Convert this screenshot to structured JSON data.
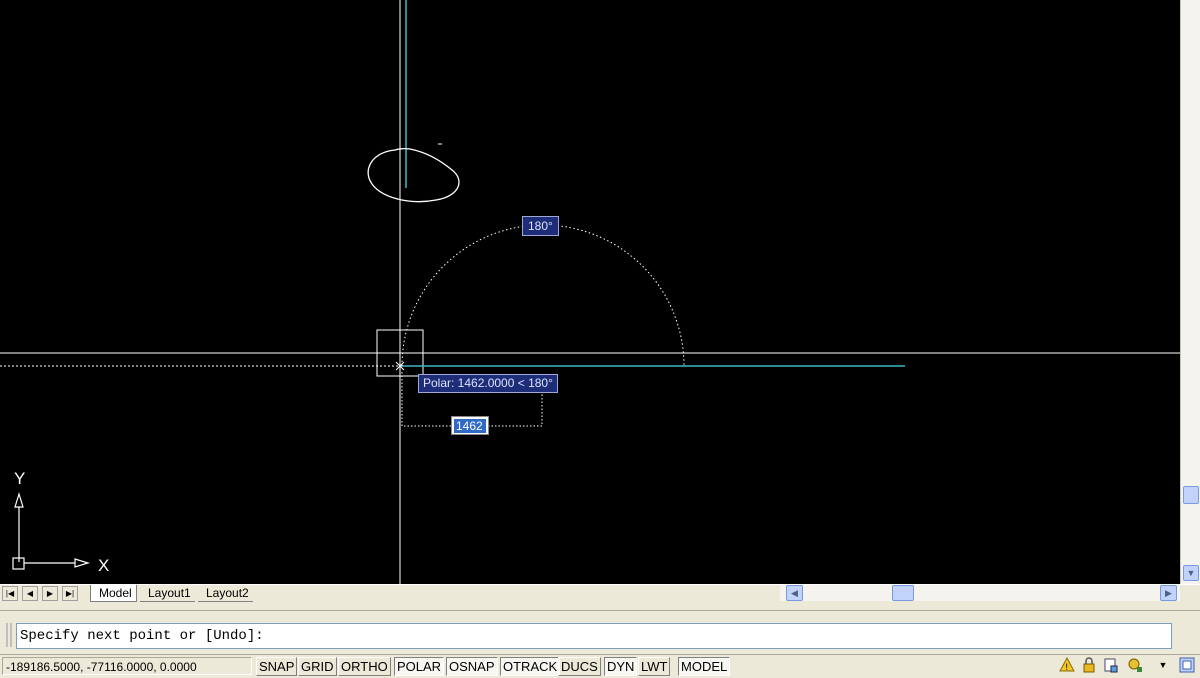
{
  "viewport": {
    "ucs_x_label": "X",
    "ucs_y_label": "Y",
    "background_color": "#000000",
    "accent_color": "#3fb8c8"
  },
  "tooltips": {
    "polar": "Polar: 1462.0000 < 180°",
    "angle": "180°",
    "length_input": "1462"
  },
  "tabs": {
    "nav_buttons": [
      "|◀",
      "◀",
      "▶",
      "▶|"
    ],
    "items": [
      {
        "label": "Model",
        "active": true
      },
      {
        "label": "Layout1",
        "active": false
      },
      {
        "label": "Layout2",
        "active": false
      }
    ]
  },
  "command": {
    "prompt": "Specify next point or [Undo]:"
  },
  "status": {
    "coordinates": "-189186.5000, -77116.0000, 0.0000",
    "toggles": [
      {
        "label": "SNAP",
        "on": false
      },
      {
        "label": "GRID",
        "on": false
      },
      {
        "label": "ORTHO",
        "on": false
      },
      {
        "label": "POLAR",
        "on": true
      },
      {
        "label": "OSNAP",
        "on": true
      },
      {
        "label": "OTRACK",
        "on": true
      },
      {
        "label": "DUCS",
        "on": false
      },
      {
        "label": "DYN",
        "on": true
      },
      {
        "label": "LWT",
        "on": false
      },
      {
        "label": "MODEL",
        "on": true
      }
    ],
    "tray_icons": [
      "comm-center-icon",
      "lock-icon",
      "xref-icon",
      "annotation-icon",
      "dropdown-arrow-icon",
      "clean-screen-icon"
    ]
  }
}
